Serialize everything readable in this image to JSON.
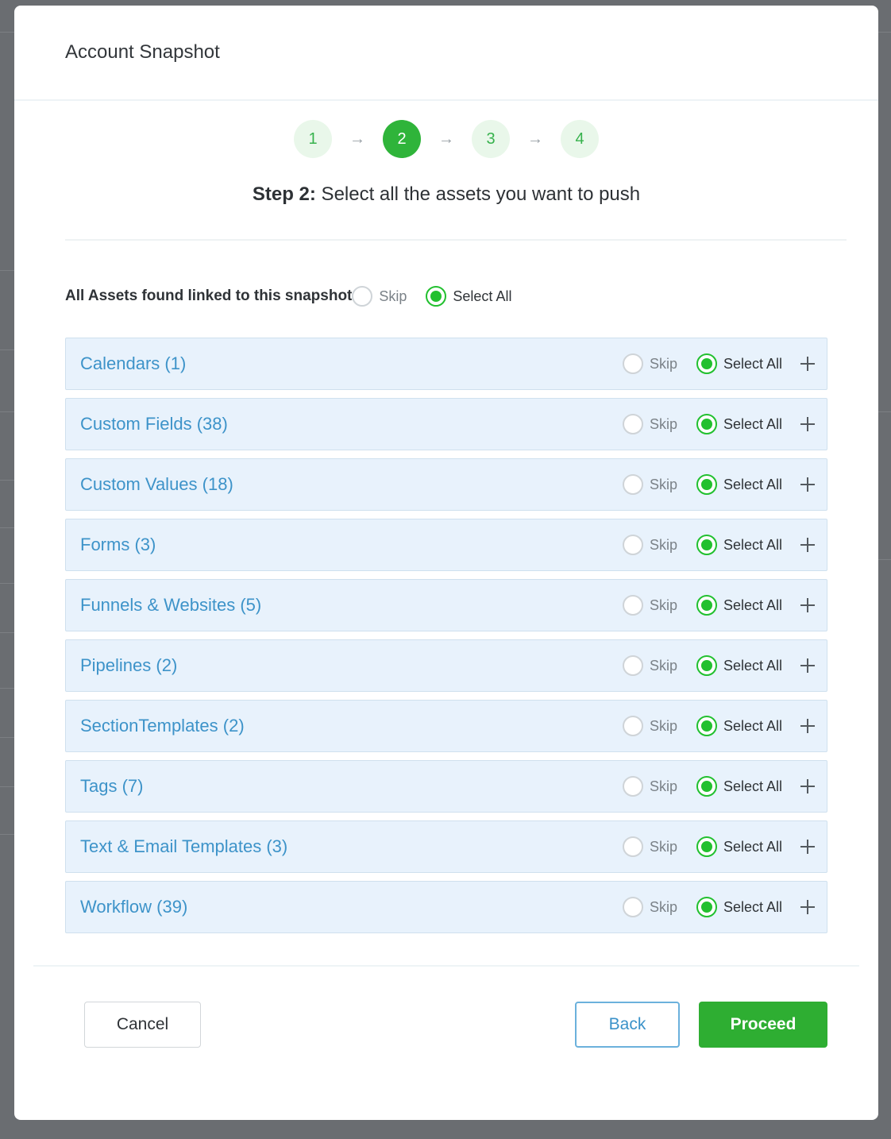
{
  "modal": {
    "title": "Account Snapshot"
  },
  "stepper": {
    "steps": [
      "1",
      "2",
      "3",
      "4"
    ],
    "active_step": 2,
    "arrow": "→"
  },
  "step_heading": {
    "prefix": "Step 2:",
    "text": " Select all the assets you want to push"
  },
  "all_assets": {
    "label": "All Assets found linked to this snapshot",
    "skip_label": "Skip",
    "select_all_label": "Select All",
    "selected": "select_all"
  },
  "assets": [
    {
      "name": "Calendars (1)",
      "skip_label": "Skip",
      "select_all_label": "Select All",
      "selected": "select_all"
    },
    {
      "name": "Custom Fields (38)",
      "skip_label": "Skip",
      "select_all_label": "Select All",
      "selected": "select_all"
    },
    {
      "name": "Custom Values (18)",
      "skip_label": "Skip",
      "select_all_label": "Select All",
      "selected": "select_all"
    },
    {
      "name": "Forms (3)",
      "skip_label": "Skip",
      "select_all_label": "Select All",
      "selected": "select_all"
    },
    {
      "name": "Funnels & Websites (5)",
      "skip_label": "Skip",
      "select_all_label": "Select All",
      "selected": "select_all"
    },
    {
      "name": "Pipelines (2)",
      "skip_label": "Skip",
      "select_all_label": "Select All",
      "selected": "select_all"
    },
    {
      "name": "SectionTemplates (2)",
      "skip_label": "Skip",
      "select_all_label": "Select All",
      "selected": "select_all"
    },
    {
      "name": "Tags (7)",
      "skip_label": "Skip",
      "select_all_label": "Select All",
      "selected": "select_all"
    },
    {
      "name": "Text & Email Templates (3)",
      "skip_label": "Skip",
      "select_all_label": "Select All",
      "selected": "select_all"
    },
    {
      "name": "Workflow (39)",
      "skip_label": "Skip",
      "select_all_label": "Select All",
      "selected": "select_all"
    }
  ],
  "footer": {
    "cancel_label": "Cancel",
    "back_label": "Back",
    "proceed_label": "Proceed"
  },
  "colors": {
    "accent_green": "#2eae32",
    "radio_green": "#22c02f",
    "link_blue": "#3d93c9",
    "row_background": "#e8f2fc"
  },
  "icons": {
    "expand": "plus-icon",
    "step_separator": "arrow-right-icon"
  }
}
